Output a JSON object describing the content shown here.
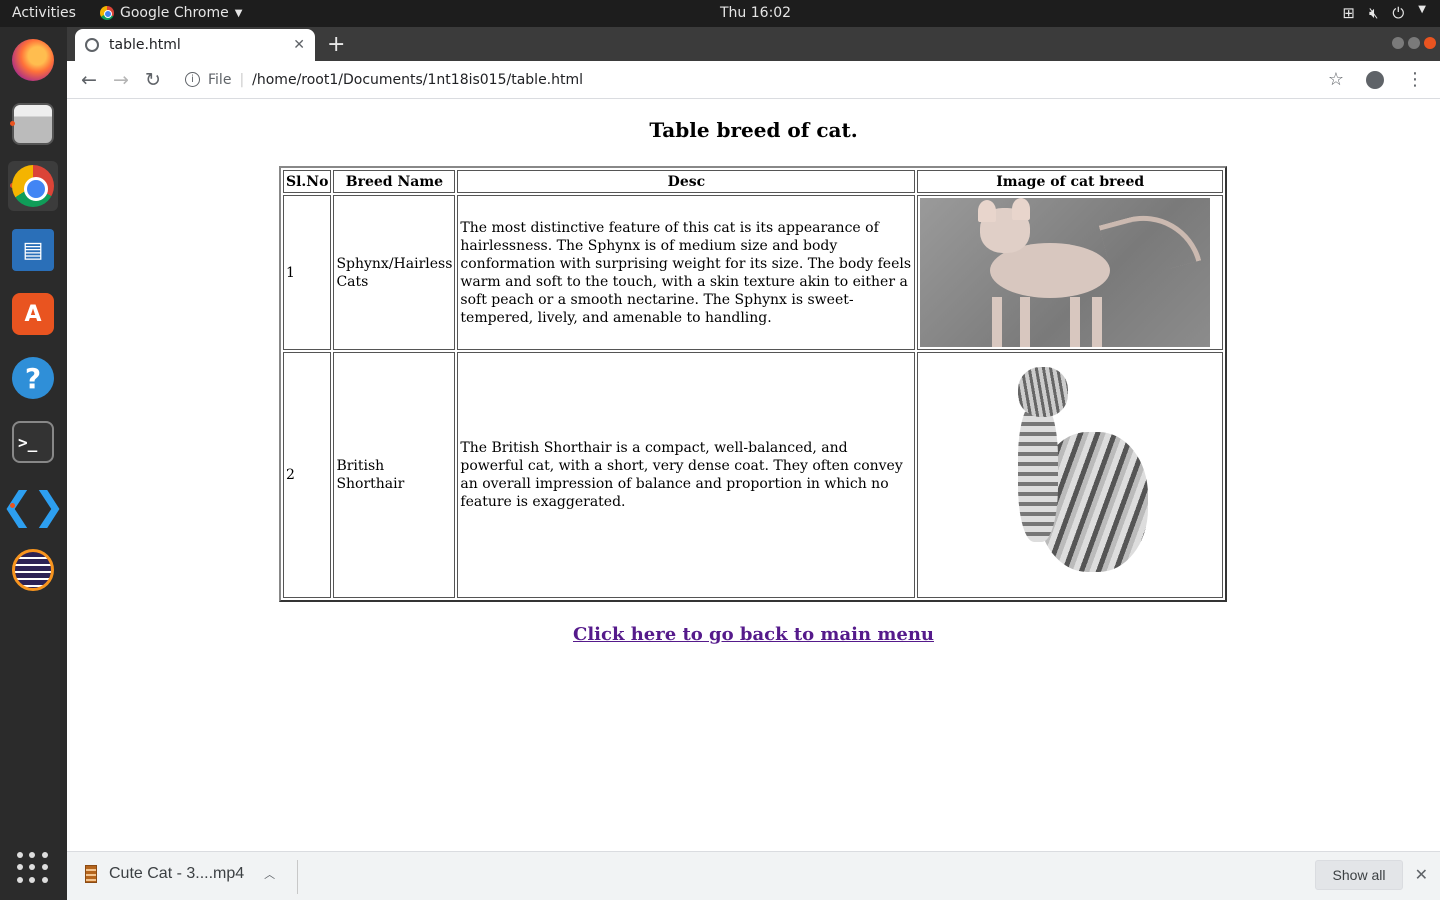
{
  "topbar": {
    "activities": "Activities",
    "app_name": "Google Chrome",
    "clock": "Thu 16:02",
    "tray_icons": [
      "network-icon",
      "volume-mute-icon",
      "power-icon"
    ]
  },
  "dock": {
    "items": [
      "firefox",
      "files",
      "chrome",
      "writer",
      "software",
      "help",
      "terminal",
      "vscode",
      "eclipse"
    ]
  },
  "browser": {
    "tab_title": "table.html",
    "address_scheme": "File",
    "address_path": "/home/root1/Documents/1nt18is015/table.html"
  },
  "page": {
    "heading": "Table breed of cat.",
    "columns": [
      "Sl.No",
      "Breed Name",
      "Desc",
      "Image of cat breed"
    ],
    "rows": [
      {
        "sl": "1",
        "breed": "Sphynx/Hairless Cats",
        "desc": "The most distinctive feature of this cat is its appearance of hairlessness. The Sphynx is of medium size and body conformation with surprising weight for its size. The body feels warm and soft to the touch, with a skin texture akin to either a soft peach or a smooth nectarine. The Sphynx is sweet-tempered, lively, and amenable to handling."
      },
      {
        "sl": "2",
        "breed": "British Shorthair",
        "desc": "The British Shorthair is a compact, well-balanced, and powerful cat, with a short, very dense coat. They often convey an overall impression of balance and proportion in which no feature is exaggerated."
      }
    ],
    "back_link": "Click here to go back to main menu"
  },
  "downloads": {
    "file_name": "Cute Cat - 3....mp4",
    "show_all": "Show all"
  }
}
